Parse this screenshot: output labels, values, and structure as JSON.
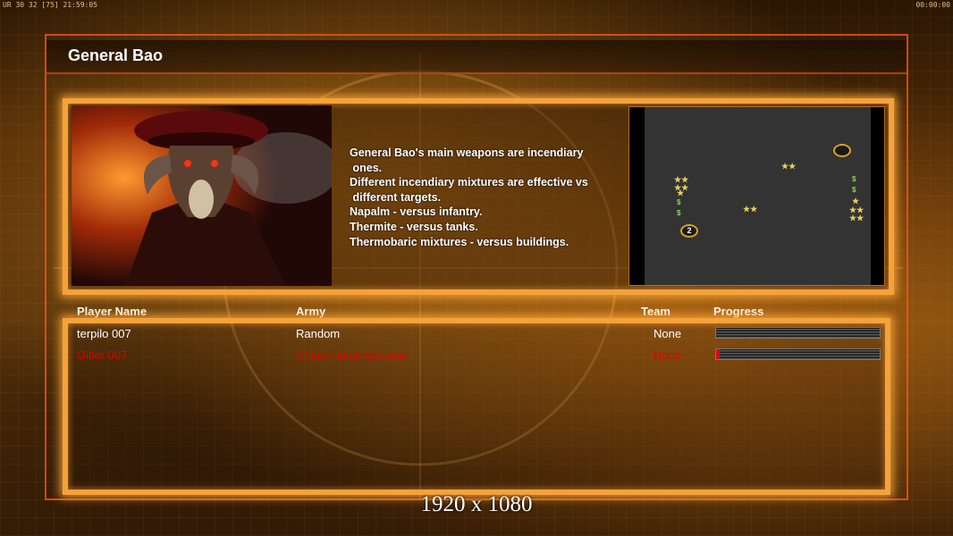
{
  "hud": {
    "left": "UR 30 32 [75] 21:59:05",
    "right": "00:00:00"
  },
  "general": {
    "title": "General Bao",
    "description_lines": [
      "General Bao's main weapons are incendiary",
      " ones.",
      "Different incendiary mixtures are effective vs",
      " different targets.",
      "Napalm - versus infantry.",
      "Thermite - versus tanks.",
      "Thermobaric mixtures - versus buildings."
    ]
  },
  "minimap": {
    "start_label": "2"
  },
  "table": {
    "headers": {
      "name": "Player Name",
      "army": "Army",
      "team": "Team",
      "progress": "Progress"
    },
    "rows": [
      {
        "name": "terpilo 007",
        "army": "Random",
        "team": "None",
        "progress": 0,
        "color": "#ffffff"
      },
      {
        "name": "Gitler 007",
        "army": "China Flame General",
        "team": "None",
        "progress": 0.02,
        "color": "#e00000"
      }
    ]
  },
  "resolution_label": "1920 x 1080",
  "colors": {
    "panel_border": "#f5a23a",
    "local_player": "#ffffff",
    "enemy_player": "#e00000",
    "accent_frame": "#ff5a14"
  }
}
